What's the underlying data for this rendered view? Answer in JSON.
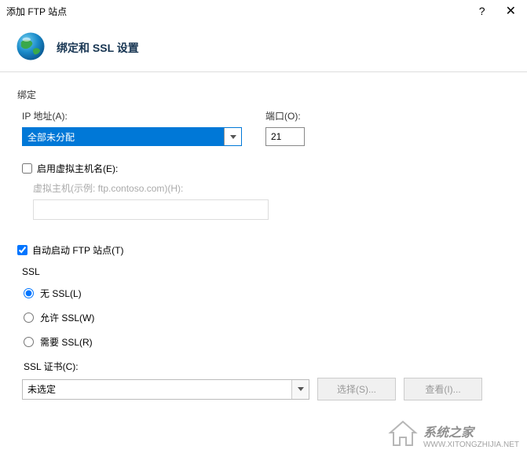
{
  "window": {
    "title": "添加 FTP 站点",
    "help": "?",
    "close": "✕"
  },
  "header": {
    "title": "绑定和 SSL 设置"
  },
  "binding": {
    "group": "绑定",
    "ip_label": "IP 地址(A):",
    "ip_value": "全部未分配",
    "port_label": "端口(O):",
    "port_value": "21"
  },
  "virtualhost": {
    "enable_label": "启用虚拟主机名(E):",
    "hint_label": "虚拟主机(示例: ftp.contoso.com)(H):",
    "value": ""
  },
  "autostart": {
    "label": "自动启动 FTP 站点(T)"
  },
  "ssl": {
    "group": "SSL",
    "none": "无 SSL(L)",
    "allow": "允许 SSL(W)",
    "require": "需要 SSL(R)",
    "cert_label": "SSL 证书(C):",
    "cert_value": "未选定",
    "select_btn": "选择(S)...",
    "view_btn": "查看(I)..."
  },
  "watermark": {
    "line1": "系统之家",
    "line2": "WWW.XITONGZHIJIA.NET"
  }
}
